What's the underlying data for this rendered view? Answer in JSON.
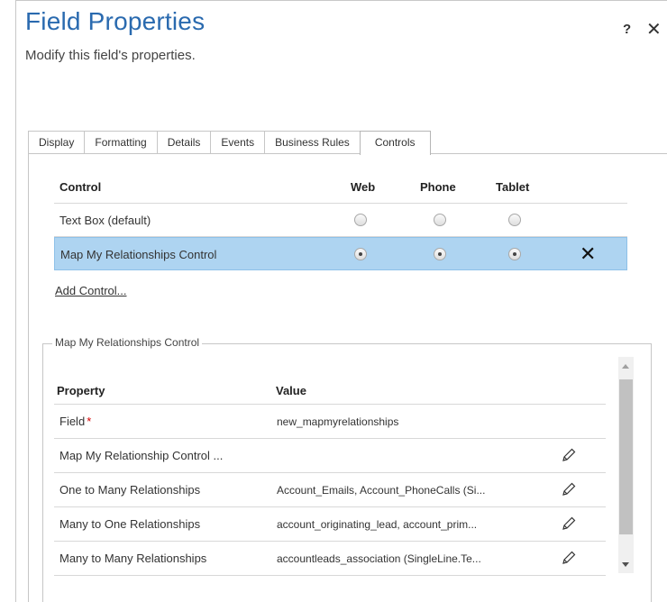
{
  "header": {
    "title": "Field Properties",
    "subtitle": "Modify this field's properties.",
    "help_label": "?",
    "close_label": "✕"
  },
  "tabs": [
    {
      "label": "Display",
      "active": false
    },
    {
      "label": "Formatting",
      "active": false
    },
    {
      "label": "Details",
      "active": false
    },
    {
      "label": "Events",
      "active": false
    },
    {
      "label": "Business Rules",
      "active": false
    },
    {
      "label": "Controls",
      "active": true
    }
  ],
  "controls": {
    "columns": {
      "control": "Control",
      "web": "Web",
      "phone": "Phone",
      "tablet": "Tablet"
    },
    "rows": [
      {
        "name": "Text Box (default)",
        "web": false,
        "phone": false,
        "tablet": false,
        "selected": false
      },
      {
        "name": "Map My Relationships Control",
        "web": true,
        "phone": true,
        "tablet": true,
        "selected": true
      }
    ],
    "delete_glyph": "✕",
    "add_control": "Add Control..."
  },
  "properties": {
    "group_title": "Map My Relationships Control",
    "columns": {
      "property": "Property",
      "value": "Value"
    },
    "required_marker": "*",
    "rows": [
      {
        "name": "Field",
        "value": "new_mapmyrelationships",
        "required": true,
        "editable": false
      },
      {
        "name": "Map My Relationship Control ...",
        "value": "",
        "required": false,
        "editable": true
      },
      {
        "name": "One to Many Relationships",
        "value": "Account_Emails, Account_PhoneCalls (Si...",
        "required": false,
        "editable": true
      },
      {
        "name": "Many to One Relationships",
        "value": "account_originating_lead, account_prim...",
        "required": false,
        "editable": true
      },
      {
        "name": "Many to Many Relationships",
        "value": "accountleads_association (SingleLine.Te...",
        "required": false,
        "editable": true
      }
    ]
  },
  "colors": {
    "title": "#2a6aaf",
    "selected_row": "#aed4f1",
    "required": "#d40000"
  },
  "icons": {
    "help": "help-icon",
    "close": "close-icon",
    "delete": "delete-control-icon",
    "edit": "pencil-icon"
  }
}
